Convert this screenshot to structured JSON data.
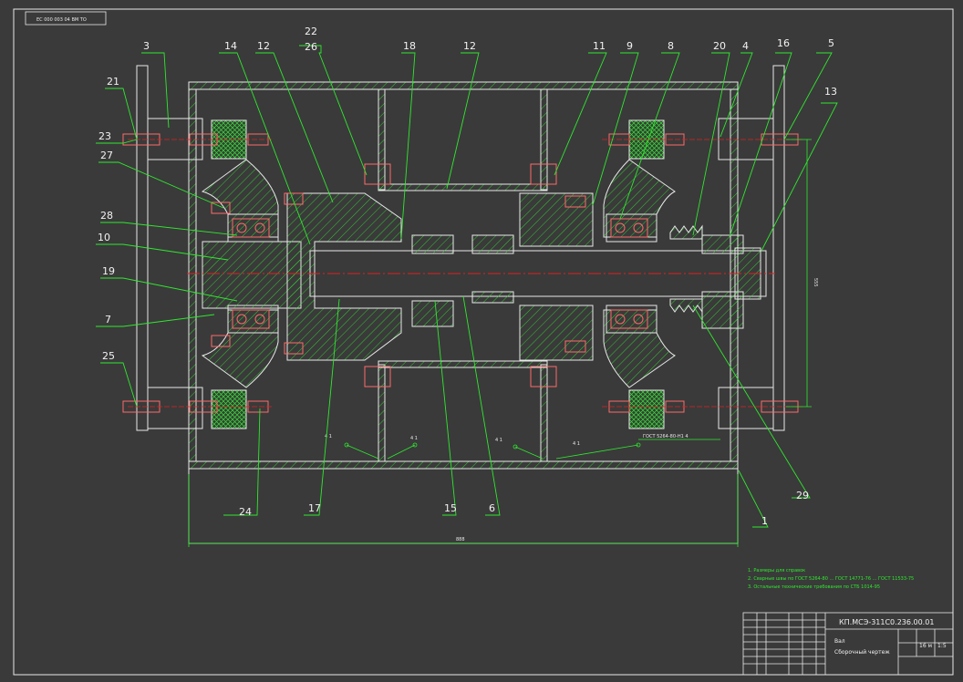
{
  "colors": {
    "background": "#3a3a3a",
    "outline": "#e8e8e8",
    "leader": "#2ee82e",
    "centerline": "#e02020",
    "fastener": "#ff6a6a",
    "label": "#f2f2f2"
  },
  "stamp_text": "ЕС 000 003 04 ВМ ТО",
  "labels": {
    "p1": "1",
    "p3": "3",
    "p4": "4",
    "p5": "5",
    "p6": "6",
    "p7": "7",
    "p8": "8",
    "p9": "9",
    "p10": "10",
    "p11": "11",
    "p12a": "12",
    "p12b": "12",
    "p13": "13",
    "p14": "14",
    "p15": "15",
    "p16": "16",
    "p17": "17",
    "p18": "18",
    "p19": "19",
    "p20": "20",
    "p21": "21",
    "p22": "22",
    "p23": "23",
    "p24": "24",
    "p25": "25",
    "p26": "26",
    "p27": "27",
    "p28": "28",
    "p29": "29"
  },
  "dimensions": {
    "width": "888",
    "height": "555",
    "weld_std": "ГОСТ 5264-80-Н1 4"
  },
  "weld_marks": {
    "w1": "4 1",
    "w2": "4 1",
    "w3": "4 1",
    "w4": "4 1"
  },
  "notes": [
    "1. Размеры для справок",
    "2. Сварные швы по ГОСТ 5264-80 ... ГОСТ 14771-76 ... ГОСТ 11533-75",
    "3. Остальные технические требования по СТБ 1014-95"
  ],
  "title_block": {
    "designation": "КП.МСЭ-311С0.236.00.01",
    "name_line1": "Вал",
    "name_line2": "Сборочный чертеж",
    "mass_cell": "16 м",
    "scale_cell": "1:5"
  }
}
